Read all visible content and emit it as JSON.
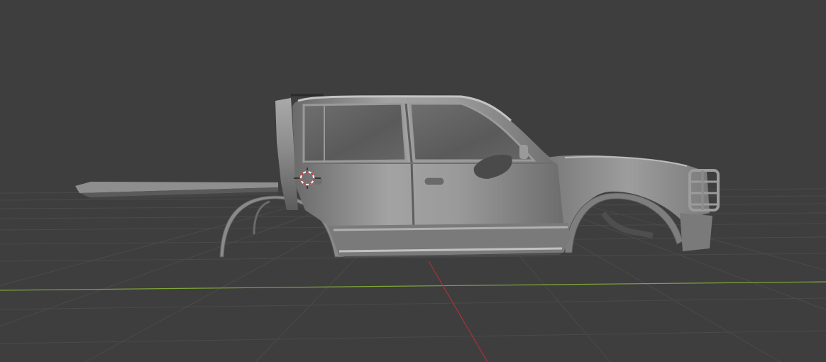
{
  "viewport": {
    "background_color": "#3e3e3e",
    "grid_line_color": "#4a4a4a",
    "x_axis_color": "#7fa63a",
    "y_axis_color": "#a8323a",
    "model_body_color": "#8a8a8a",
    "model_highlight_color": "#bdbdbd",
    "model_shadow_color": "#4e4e4e",
    "cursor_color": "#d7313a",
    "cursor_icon": "3d-cursor-icon"
  }
}
